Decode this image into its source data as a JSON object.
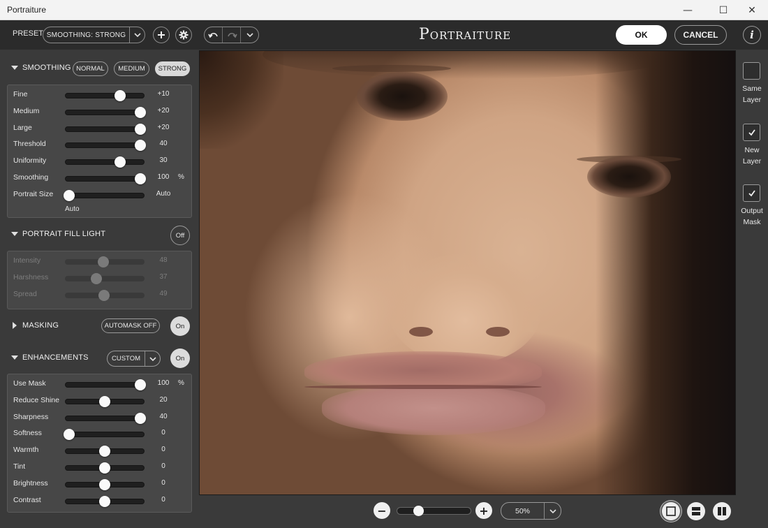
{
  "window": {
    "title": "Portraiture",
    "controls": {
      "minimize": "—",
      "maximize": "☐",
      "close": "✕"
    }
  },
  "toolbar": {
    "preset_label": "PRESET",
    "preset_value": "SMOOTHING: STRONG",
    "app_title": "Portraiture",
    "ok_label": "OK",
    "cancel_label": "CANCEL",
    "info_label": "i"
  },
  "smoothing": {
    "header": "SMOOTHING",
    "modes": [
      "NORMAL",
      "MEDIUM",
      "STRONG"
    ],
    "active_mode": "STRONG",
    "sliders": [
      {
        "label": "Fine",
        "value": "+10",
        "unit": "",
        "fraction": 0.72
      },
      {
        "label": "Medium",
        "value": "+20",
        "unit": "",
        "fraction": 1.0
      },
      {
        "label": "Large",
        "value": "+20",
        "unit": "",
        "fraction": 1.0
      },
      {
        "label": "Threshold",
        "value": "40",
        "unit": "",
        "fraction": 1.0
      },
      {
        "label": "Uniformity",
        "value": "30",
        "unit": "",
        "fraction": 0.72
      },
      {
        "label": "Smoothing",
        "value": "100",
        "unit": "%",
        "fraction": 1.0
      },
      {
        "label": "Portrait Size",
        "value": "Auto",
        "unit": "",
        "fraction": 0.0
      }
    ],
    "portrait_size_sub": "Auto"
  },
  "fill_light": {
    "header": "PORTRAIT FILL LIGHT",
    "toggle": "Off",
    "sliders": [
      {
        "label": "Intensity",
        "value": "48",
        "unit": "",
        "fraction": 0.48
      },
      {
        "label": "Harshness",
        "value": "37",
        "unit": "",
        "fraction": 0.38
      },
      {
        "label": "Spread",
        "value": "49",
        "unit": "",
        "fraction": 0.49
      }
    ]
  },
  "masking": {
    "header": "MASKING",
    "automask_label": "AUTOMASK OFF",
    "toggle": "On"
  },
  "enhancements": {
    "header": "ENHANCEMENTS",
    "preset": "CUSTOM",
    "toggle": "On",
    "sliders": [
      {
        "label": "Use Mask",
        "value": "100",
        "unit": "%",
        "fraction": 1.0
      },
      {
        "label": "Reduce Shine",
        "value": "20",
        "unit": "",
        "fraction": 0.5
      },
      {
        "label": "Sharpness",
        "value": "40",
        "unit": "",
        "fraction": 1.0
      },
      {
        "label": "Softness",
        "value": "0",
        "unit": "",
        "fraction": 0.0
      },
      {
        "label": "Warmth",
        "value": "0",
        "unit": "",
        "fraction": 0.5
      },
      {
        "label": "Tint",
        "value": "0",
        "unit": "",
        "fraction": 0.5
      },
      {
        "label": "Brightness",
        "value": "0",
        "unit": "",
        "fraction": 0.5
      },
      {
        "label": "Contrast",
        "value": "0",
        "unit": "",
        "fraction": 0.5
      }
    ]
  },
  "zoom": {
    "value": "50%",
    "slider_fraction": 0.25,
    "minus": "−",
    "plus": "+"
  },
  "output": [
    {
      "label_line1": "Same",
      "label_line2": "Layer",
      "checked": false
    },
    {
      "label_line1": "New",
      "label_line2": "Layer",
      "checked": true
    },
    {
      "label_line1": "Output",
      "label_line2": "Mask",
      "checked": true
    }
  ],
  "colors": {
    "panel": "#3a3a3a",
    "toolbar": "#2b2b2b",
    "section_box": "#474747",
    "knob": "#fafafa",
    "accent_white": "#ffffff"
  }
}
